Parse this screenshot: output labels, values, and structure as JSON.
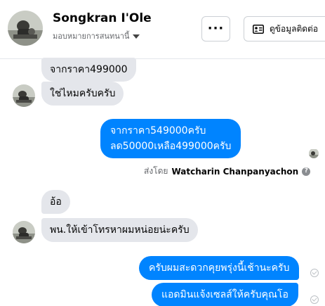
{
  "header": {
    "name": "Songkran I'Ole",
    "subtitle": "มอบหมายการสนทนานี้",
    "more_label": "···",
    "contact_button_label": "ดูข้อมูลติดต่อ"
  },
  "messages": [
    {
      "direction": "incoming",
      "text": "จากราคา499000"
    },
    {
      "direction": "incoming",
      "text": "ใช่ไหมครับครับ"
    },
    {
      "direction": "outgoing",
      "lines": [
        "จากราคา549000ครับ",
        "ลด50000เหลือ499000ครับ"
      ]
    },
    {
      "direction": "incoming",
      "text": "อ้อ"
    },
    {
      "direction": "incoming",
      "text": "พน.ให้เข้าโทรหาผมหน่อยน่ะครับ"
    },
    {
      "direction": "outgoing",
      "text": "ครับผมสะดวกคุยพรุ่งนี้เช้านะครับ"
    },
    {
      "direction": "outgoing",
      "text": "แอดมินแจ้งเซลส์ให้ครับคุณโอ"
    }
  ],
  "sent_by": {
    "prefix": "ส่งโดย",
    "name": "Watcharin Chanpanyachon"
  },
  "colors": {
    "outgoing_bubble": "#0084ff",
    "incoming_bubble": "#e4e6eb",
    "secondary_text": "#65676b"
  },
  "icons": {
    "more": "more-horizontal-icon",
    "contact": "contact-card-icon",
    "help": "help-circle-icon",
    "delivered": "delivered-check-icon"
  }
}
